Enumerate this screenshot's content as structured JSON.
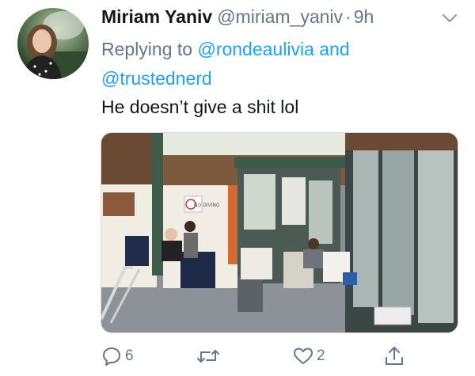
{
  "tweet": {
    "author_name": "Miriam Yaniv",
    "author_handle": "@miriam_yaniv",
    "separator": "·",
    "timestamp": "9h",
    "replying_prefix": "Replying to",
    "mention_1": "@rondeaulivia",
    "mention_joiner": "and",
    "mention_2": "@trustednerd",
    "text": "He doesn’t give a shit lol",
    "avatar_icon": "profile-photo",
    "media": {
      "sign_text": "NO DIVING"
    }
  },
  "actions": {
    "reply": {
      "icon": "reply-icon",
      "count": "6"
    },
    "retweet": {
      "icon": "retweet-icon",
      "count": ""
    },
    "like": {
      "icon": "heart-icon",
      "count": "2"
    },
    "share": {
      "icon": "share-icon",
      "count": ""
    }
  },
  "colors": {
    "text_primary": "#14171a",
    "text_secondary": "#657786",
    "accent": "#1da1f2"
  }
}
